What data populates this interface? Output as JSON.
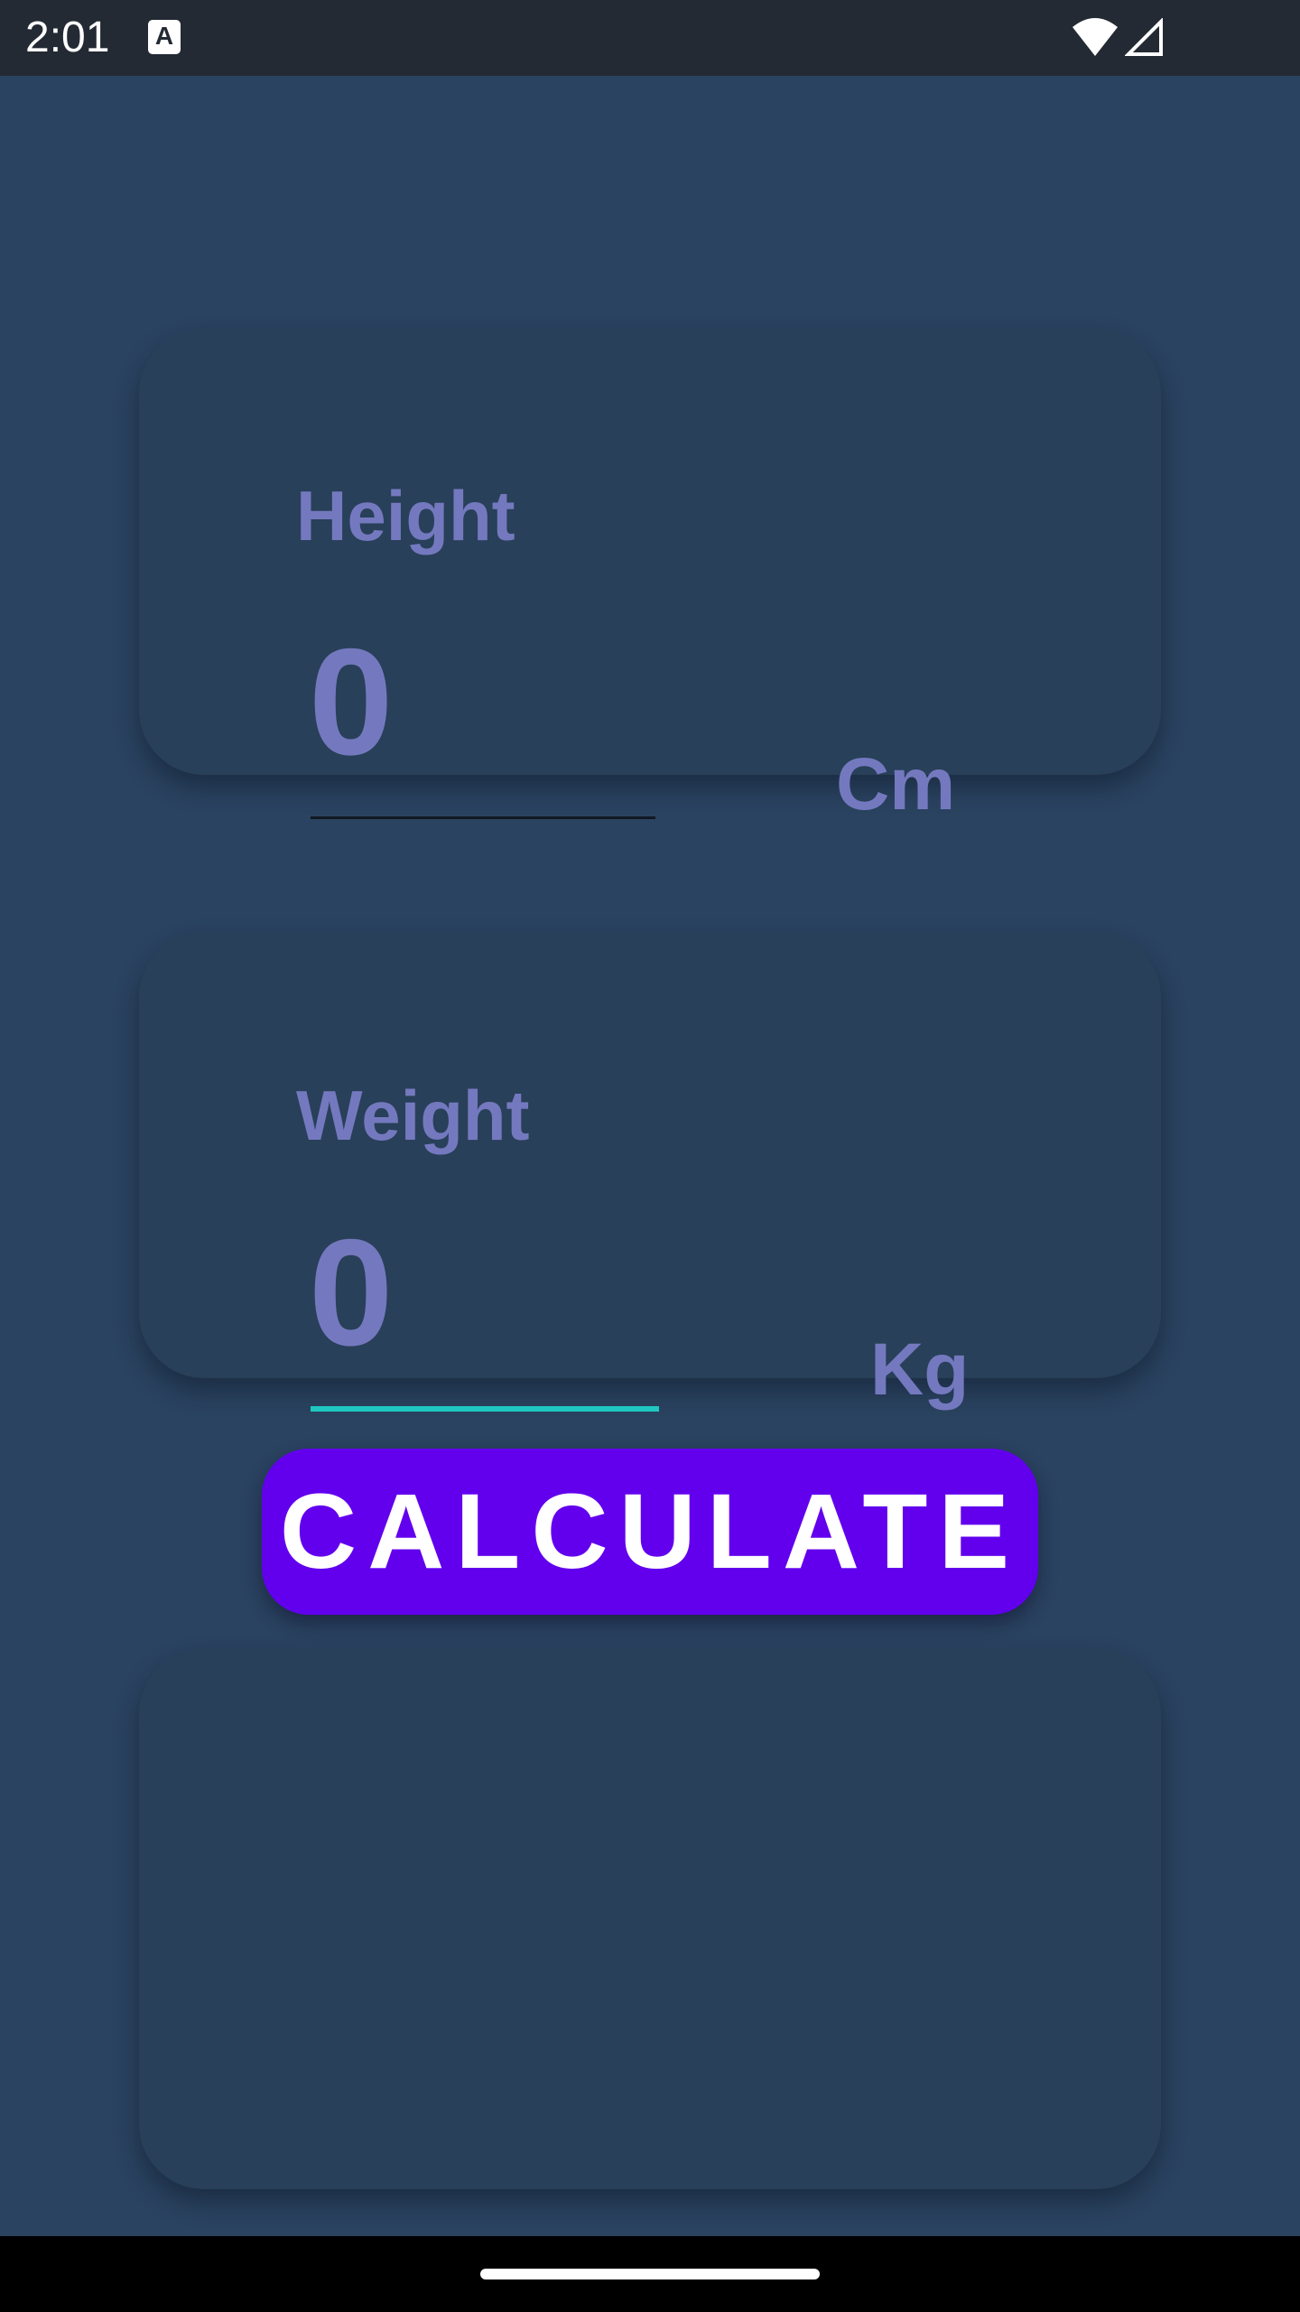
{
  "status_bar": {
    "time": "2:01",
    "notification_icon": "text-format-icon",
    "notification_glyph": "A",
    "wifi_icon": "wifi-icon",
    "signal_icon": "cell-signal-icon"
  },
  "height_card": {
    "label": "Height",
    "value": "0",
    "unit": "Cm"
  },
  "weight_card": {
    "label": "Weight",
    "value": "0",
    "unit": "Kg",
    "focused": true
  },
  "calculate_button": {
    "label": "CALCULATE"
  },
  "colors": {
    "background": "#2a4360",
    "card": "#284059",
    "label_text": "#7479bf",
    "button": "#6200ee",
    "focus_underline": "#1ec8c0",
    "status_bar": "#232a34"
  }
}
